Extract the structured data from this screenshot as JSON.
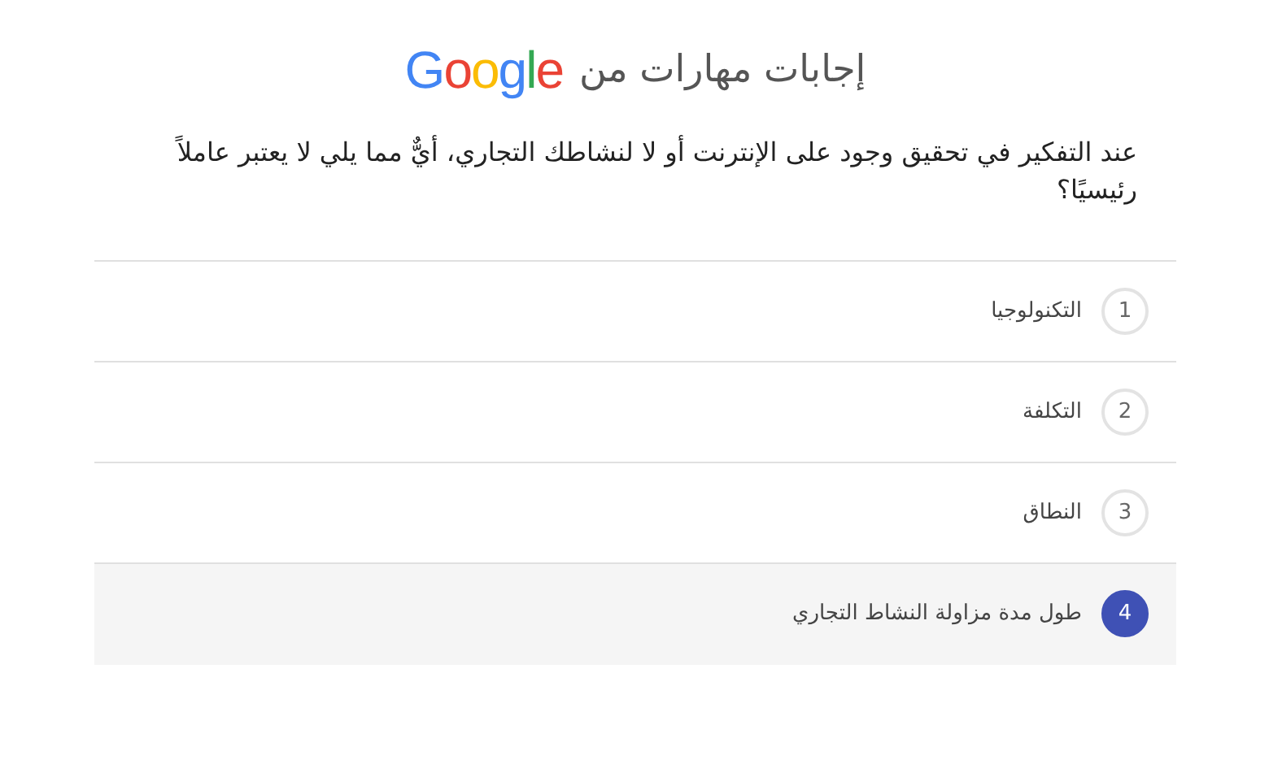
{
  "header": {
    "title": "إجابات مهارات من",
    "logo": "Google"
  },
  "question": "عند التفكير في تحقيق وجود على الإنترنت أو لا لنشاطك التجاري، أيٌّ مما يلي لا يعتبر عاملاً رئيسيًا؟",
  "options": [
    {
      "number": "1",
      "label": "التكنولوجيا",
      "selected": false
    },
    {
      "number": "2",
      "label": "التكلفة",
      "selected": false
    },
    {
      "number": "3",
      "label": "النطاق",
      "selected": false
    },
    {
      "number": "4",
      "label": "طول مدة مزاولة النشاط التجاري",
      "selected": true
    }
  ]
}
